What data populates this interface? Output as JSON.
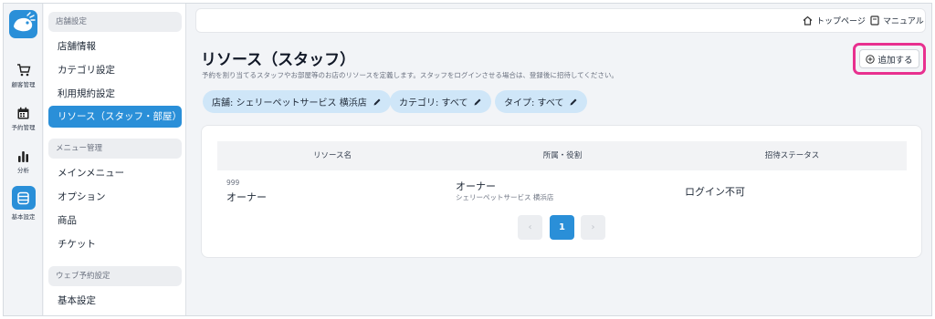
{
  "nav_rail": {
    "items": [
      {
        "label": "顧客管理",
        "icon": "cart-icon"
      },
      {
        "label": "予約管理",
        "icon": "calendar-icon"
      },
      {
        "label": "分析",
        "icon": "bar-chart-icon"
      },
      {
        "label": "基本設定",
        "icon": "database-icon",
        "active": true
      }
    ]
  },
  "sidebar": {
    "sections": [
      {
        "heading": "店舗設定",
        "items": [
          "店舗情報",
          "カテゴリ設定",
          "利用規約設定",
          "リソース（スタッフ・部屋）"
        ]
      },
      {
        "heading": "メニュー管理",
        "items": [
          "メインメニュー",
          "オプション",
          "商品",
          "チケット"
        ]
      },
      {
        "heading": "ウェブ予約設定",
        "items": [
          "基本設定"
        ]
      }
    ],
    "active_item": "リソース（スタッフ・部屋）"
  },
  "topbar": {
    "top_page": "トップページ",
    "manual": "マニュアル"
  },
  "page": {
    "title": "リソース（スタッフ）",
    "description": "予約を割り当てるスタッフやお部屋等のお店のリソースを定義します。スタッフをログインさせる場合は、登録後に招待してください。",
    "add_button": "追加する"
  },
  "filters": [
    {
      "label": "店舗: シェリーペットサービス 横浜店"
    },
    {
      "label": "カテゴリ: すべて"
    },
    {
      "label": "タイプ: すべて"
    }
  ],
  "table": {
    "columns": [
      "リソース名",
      "所属・役割",
      "招待ステータス"
    ],
    "rows": [
      {
        "id": "999",
        "name": "オーナー",
        "role": "オーナー",
        "store": "シェリーペットサービス 横浜店",
        "invite_status": "ログイン不可"
      }
    ]
  },
  "pagination": {
    "prev": "‹",
    "current": "1",
    "next": "›"
  },
  "colors": {
    "accent": "#2a8fd8",
    "highlight": "#e8308f",
    "chip": "#cfe6f8"
  }
}
